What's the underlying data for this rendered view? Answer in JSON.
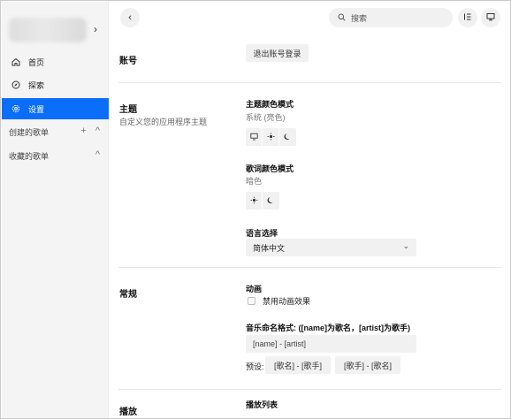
{
  "sidebar": {
    "nav": [
      {
        "label": "首页",
        "icon": "home-icon"
      },
      {
        "label": "探索",
        "icon": "compass-icon"
      },
      {
        "label": "设置",
        "icon": "settings-icon",
        "active": true
      }
    ],
    "sections": [
      {
        "label": "创建的歌单",
        "add": "+",
        "collapse": "^"
      },
      {
        "label": "收藏的歌单",
        "collapse": "^"
      }
    ]
  },
  "topbar": {
    "search_placeholder": "搜索"
  },
  "settings": {
    "account": {
      "title": "账号",
      "logout_label": "退出账号登录"
    },
    "theme": {
      "title": "主题",
      "subtitle": "自定义您的应用程序主题",
      "color_mode_label": "主题颜色模式",
      "color_mode_value": "系统 (亮色)",
      "lyric_mode_label": "歌词颜色模式",
      "lyric_mode_value": "暗色",
      "language_label": "语言选择",
      "language_value": "简体中文"
    },
    "general": {
      "title": "常规",
      "animation_label": "动画",
      "disable_animation_label": "禁用动画效果",
      "naming_label": "音乐命名格式: ([name]为歌名，[artist]为歌手)",
      "naming_value": "[name] - [artist]",
      "preset_label": "预设:",
      "presets": [
        "[歌名] - [歌手]",
        "[歌手] - [歌名]"
      ]
    },
    "playback": {
      "title": "播放",
      "playlist_label": "播放列表"
    }
  },
  "colors": {
    "accent": "#0b6ef8",
    "sidebar_bg": "#f4f4f5",
    "control_bg": "#f1f1f2"
  }
}
